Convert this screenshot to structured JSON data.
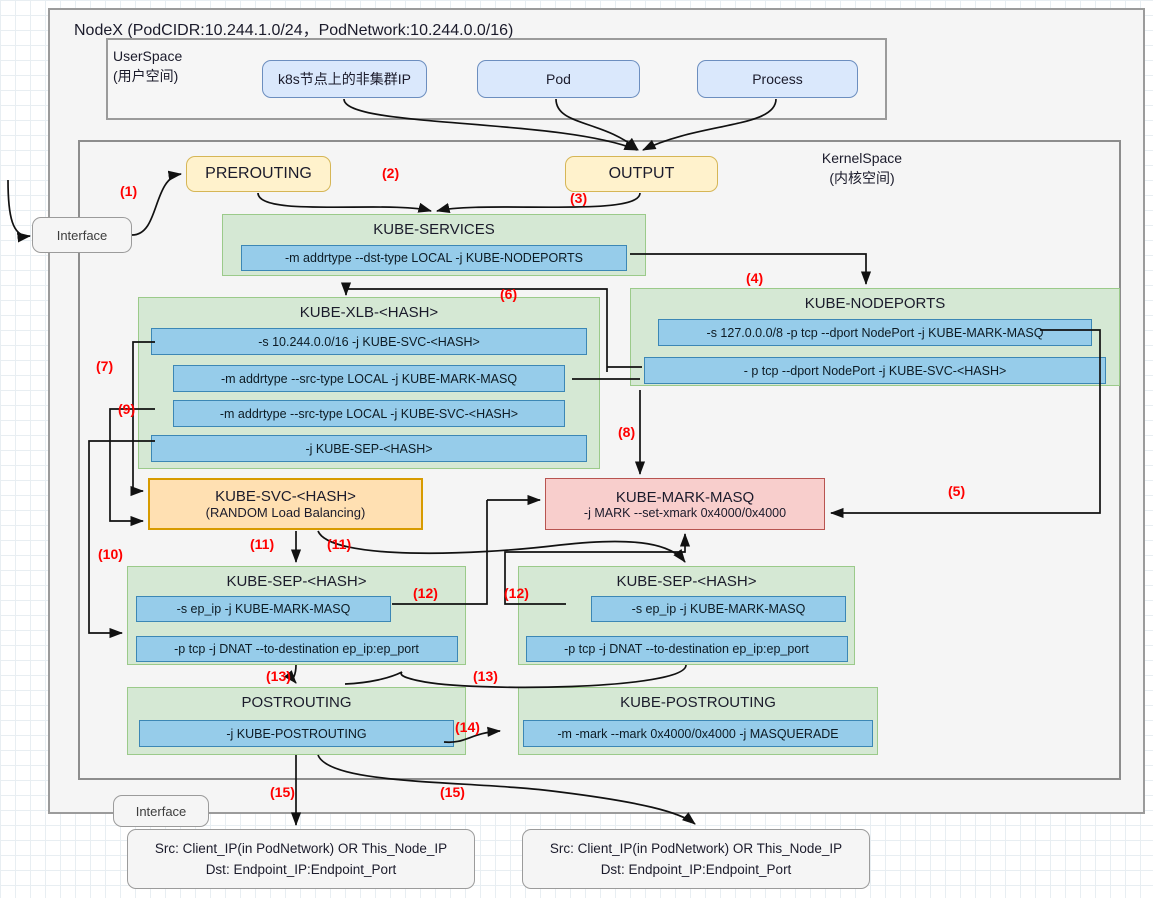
{
  "node": {
    "title": "NodeX (PodCIDR:10.244.1.0/24，PodNetwork:10.244.0.0/16)"
  },
  "userspace": {
    "label": "UserSpace\n(用户空间)",
    "label_en": "UserSpace",
    "label_cn": "(用户空间)",
    "boxes": [
      {
        "label": "k8s节点上的非集群IP"
      },
      {
        "label": "Pod"
      },
      {
        "label": "Process"
      }
    ]
  },
  "kernelspace": {
    "label_en": "KernelSpace",
    "label_cn": "(内核空间)"
  },
  "interfaces": {
    "top": "Interface",
    "bottom": "Interface"
  },
  "chains": {
    "prerouting": "PREROUTING",
    "output": "OUTPUT",
    "kube_services": {
      "title": "KUBE-SERVICES",
      "rules": [
        "-m addrtype --dst-type LOCAL -j KUBE-NODEPORTS"
      ]
    },
    "kube_nodeports": {
      "title": "KUBE-NODEPORTS",
      "rules": [
        "-s 127.0.0.0/8 -p tcp --dport NodePort -j KUBE-MARK-MASQ",
        "- p tcp --dport  NodePort -j KUBE-SVC-<HASH>"
      ]
    },
    "kube_xlb": {
      "title": "KUBE-XLB-<HASH>",
      "rules": [
        "-s 10.244.0.0/16 -j KUBE-SVC-<HASH>",
        "-m addrtype --src-type LOCAL -j KUBE-MARK-MASQ",
        "-m addrtype --src-type LOCAL -j KUBE-SVC-<HASH>",
        "-j KUBE-SEP-<HASH>"
      ]
    },
    "kube_svc": {
      "title": "KUBE-SVC-<HASH>",
      "subtitle": "(RANDOM Load Balancing)"
    },
    "kube_mark_masq": {
      "title": "KUBE-MARK-MASQ",
      "rule": "-j MARK --set-xmark 0x4000/0x4000"
    },
    "kube_sep_left": {
      "title": "KUBE-SEP-<HASH>",
      "rules": [
        "-s ep_ip -j KUBE-MARK-MASQ",
        "-p tcp -j DNAT --to-destination ep_ip:ep_port"
      ]
    },
    "kube_sep_right": {
      "title": "KUBE-SEP-<HASH>",
      "rules": [
        "-s ep_ip -j KUBE-MARK-MASQ",
        "-p tcp -j DNAT --to-destination ep_ip:ep_port"
      ]
    },
    "postrouting": {
      "title": "POSTROUTING",
      "rules": [
        "-j KUBE-POSTROUTING"
      ]
    },
    "kube_postrouting": {
      "title": "KUBE-POSTROUTING",
      "rules": [
        "-m -mark --mark 0x4000/0x4000 -j MASQUERADE"
      ]
    }
  },
  "packets": {
    "left": {
      "src": "Src: Client_IP(in PodNetwork) OR This_Node_IP",
      "dst": "Dst: Endpoint_IP:Endpoint_Port"
    },
    "right": {
      "src": "Src: Client_IP(in PodNetwork) OR This_Node_IP",
      "dst": "Dst: Endpoint_IP:Endpoint_Port"
    }
  },
  "steps": [
    {
      "id": "s1",
      "label": "(1)"
    },
    {
      "id": "s2",
      "label": "(2)"
    },
    {
      "id": "s3",
      "label": "(3)"
    },
    {
      "id": "s4",
      "label": "(4)"
    },
    {
      "id": "s5",
      "label": "(5)"
    },
    {
      "id": "s6",
      "label": "(6)"
    },
    {
      "id": "s7",
      "label": "(7)"
    },
    {
      "id": "s8",
      "label": "(8)"
    },
    {
      "id": "s9",
      "label": "(9)"
    },
    {
      "id": "s10",
      "label": "(10)"
    },
    {
      "id": "s11a",
      "label": "(11)"
    },
    {
      "id": "s11b",
      "label": "(11)"
    },
    {
      "id": "s12a",
      "label": "(12)"
    },
    {
      "id": "s12b",
      "label": "(12)"
    },
    {
      "id": "s13a",
      "label": "(13)"
    },
    {
      "id": "s13b",
      "label": "(13)"
    },
    {
      "id": "s14",
      "label": "(14)"
    },
    {
      "id": "s15a",
      "label": "(15)"
    },
    {
      "id": "s15b",
      "label": "(15)"
    }
  ],
  "colors": {
    "userspace_box": "#dae8fc",
    "userspace_border": "#6c8ebf",
    "chain_box": "#ffe6cc",
    "chain_border": "#d6b656",
    "group": "#d5e8d4",
    "group_border": "#9bca8a",
    "rule": "#96ccea",
    "rule_border": "#3c87b5",
    "svc": "#ffe0b2",
    "svc_border": "#d79b00",
    "masq": "#f8cecc",
    "masq_border": "#b85450",
    "step_number": "#ff0000"
  }
}
